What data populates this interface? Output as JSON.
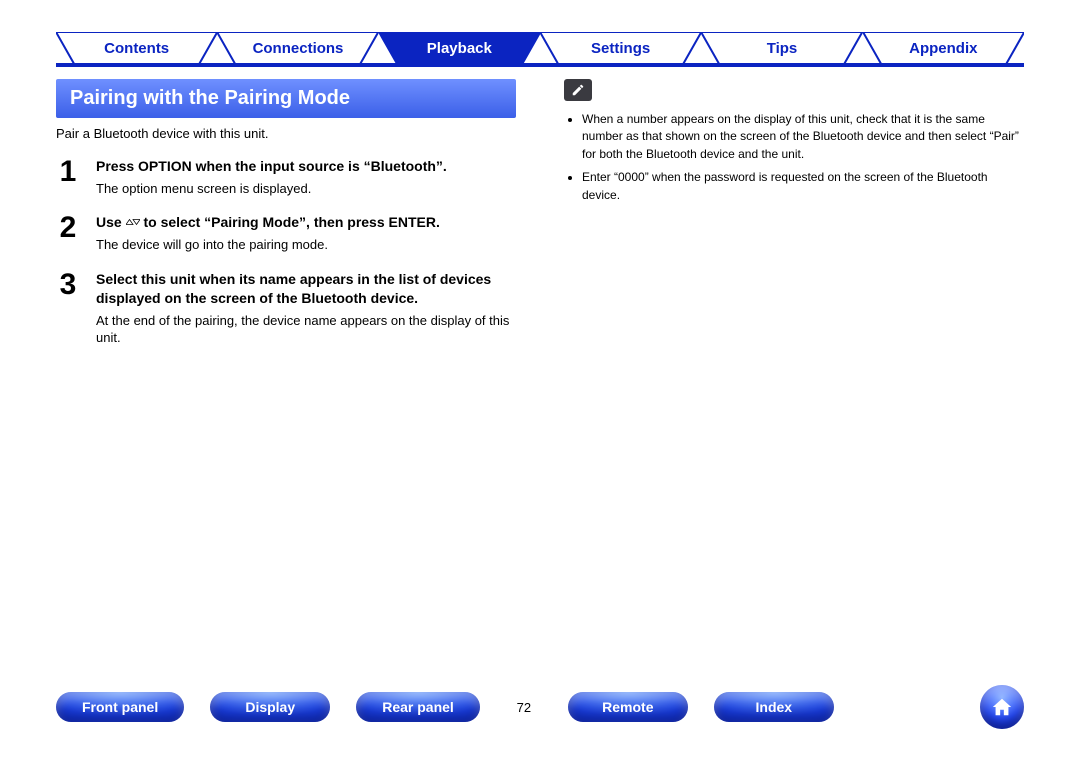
{
  "tabs": [
    {
      "label": "Contents",
      "active": false
    },
    {
      "label": "Connections",
      "active": false
    },
    {
      "label": "Playback",
      "active": true
    },
    {
      "label": "Settings",
      "active": false
    },
    {
      "label": "Tips",
      "active": false
    },
    {
      "label": "Appendix",
      "active": false
    }
  ],
  "section_title": "Pairing with the Pairing Mode",
  "lead": "Pair a Bluetooth device with this unit.",
  "steps": [
    {
      "n": "1",
      "head": "Press OPTION when the input source is “Bluetooth”.",
      "sub": "The option menu screen is displayed."
    },
    {
      "n": "2",
      "head_pre": "Use ",
      "head_post": " to select “Pairing Mode”, then press ENTER.",
      "sub": "The device will go into the pairing mode."
    },
    {
      "n": "3",
      "head": "Select this unit when its name appears in the list of devices displayed on the screen of the Bluetooth device.",
      "sub": "At the end of the pairing, the device name appears on the display of this unit."
    }
  ],
  "notes": [
    "When a number appears on the display of this unit, check that it is the same number as that shown on the screen of the Bluetooth device and then select “Pair” for both the Bluetooth device and the unit.",
    "Enter “0000” when the password is requested on the screen of the Bluetooth device."
  ],
  "footer": {
    "items": [
      "Front panel",
      "Display",
      "Rear panel",
      "Remote",
      "Index"
    ],
    "page": "72"
  }
}
